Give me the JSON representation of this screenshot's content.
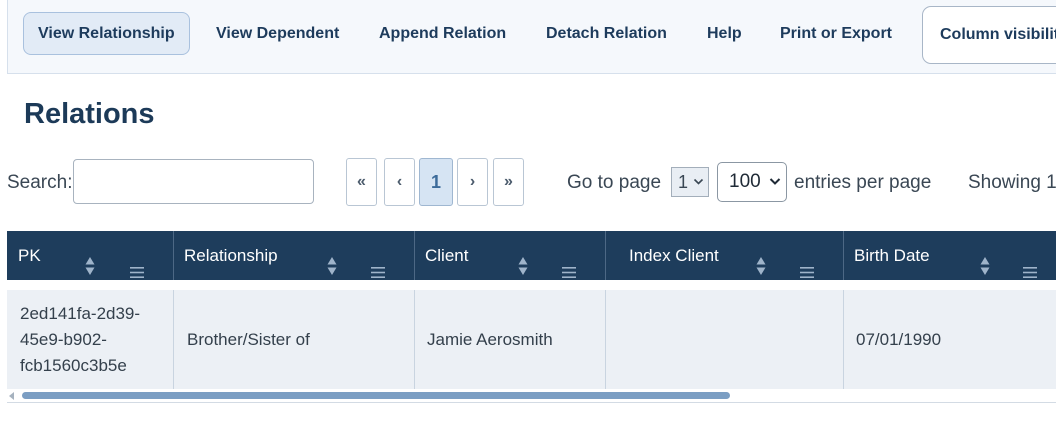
{
  "toolbar": {
    "view_relationship": "View Relationship",
    "view_dependent": "View Dependent",
    "append_relation": "Append Relation",
    "detach_relation": "Detach Relation",
    "help": "Help",
    "print_export": "Print or Export",
    "column_visibility": "Column visibility"
  },
  "page": {
    "title": "Relations"
  },
  "search": {
    "label": "Search:",
    "value": ""
  },
  "pagination": {
    "first": "«",
    "prev": "‹",
    "current": "1",
    "next": "›",
    "last": "»",
    "goto_label": "Go to page",
    "goto_value": "1",
    "entries_value": "100",
    "entries_label": "entries per page",
    "showing": "Showing 1"
  },
  "table": {
    "headers": [
      "PK",
      "Relationship",
      "Client",
      "Index Client",
      "Birth Date"
    ],
    "rows": [
      {
        "pk_lines": [
          "2ed141fa-2d39-",
          "45e9-b902-",
          "fcb1560c3b5e"
        ],
        "relationship": "Brother/Sister of",
        "client": "Jamie Aerosmith",
        "index_client": "",
        "birth_date": "07/01/1990"
      }
    ]
  },
  "colors": {
    "header_bg": "#1e3d5c",
    "row_bg": "#ecf0f5",
    "accent": "#1d3b5c",
    "scroll_thumb": "#7b9ec3"
  }
}
